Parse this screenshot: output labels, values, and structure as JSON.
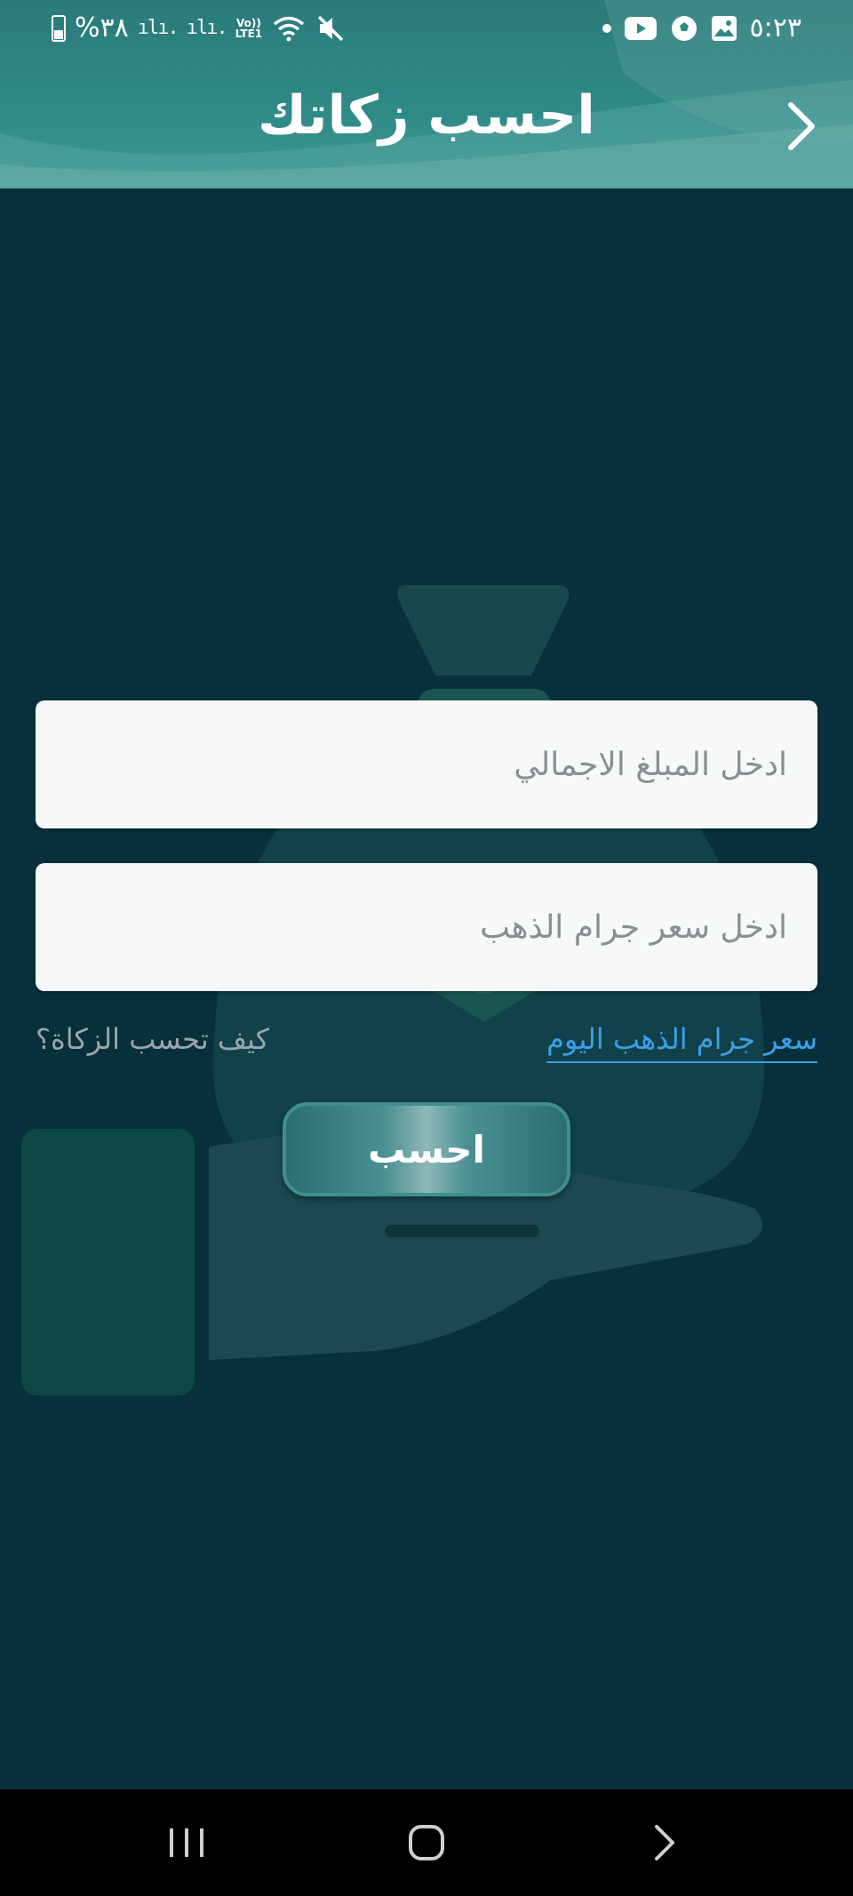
{
  "status_bar": {
    "battery_text": "%٣٨",
    "lte_top": "Vo))",
    "lte_bottom": "LTE1",
    "time": "٥:٢٣"
  },
  "header": {
    "title": "احسب زكاتك"
  },
  "form": {
    "amount_placeholder": "ادخل المبلغ الاجمالي",
    "amount_value": "",
    "gold_price_placeholder": "ادخل سعر جرام الذهب",
    "gold_price_value": ""
  },
  "links": {
    "gold_price_today": "سعر جرام الذهب اليوم",
    "how_to_calculate": "كيف تحسب الزكاة؟"
  },
  "calculate_button": {
    "label": "احسب"
  },
  "colors": {
    "header_teal": "#2f8a87",
    "background": "#072f3c",
    "link_blue": "#3aa0e8"
  }
}
